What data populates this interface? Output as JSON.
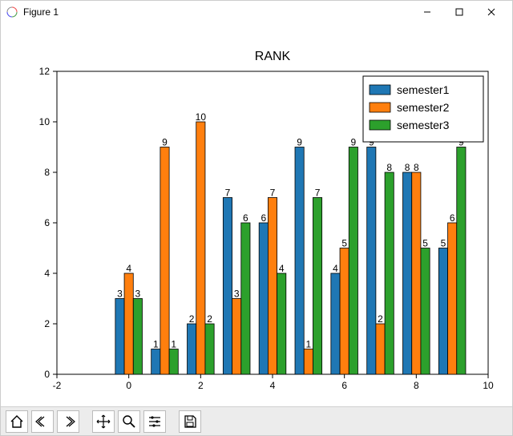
{
  "window": {
    "title": "Figure 1"
  },
  "toolbar_icons": {
    "home": "home-icon",
    "back": "back-icon",
    "forward": "forward-icon",
    "pan": "pan-icon",
    "zoom": "zoom-icon",
    "configure": "configure-icon",
    "save": "save-icon"
  },
  "chart_data": {
    "type": "bar",
    "title": "RANK",
    "xlabel": "",
    "ylabel": "",
    "xlim": [
      -2,
      10
    ],
    "ylim": [
      0,
      12
    ],
    "xticks": [
      -2,
      0,
      2,
      4,
      6,
      8,
      10
    ],
    "yticks": [
      0,
      2,
      4,
      6,
      8,
      10,
      12
    ],
    "categories": [
      0,
      1,
      2,
      3,
      4,
      5,
      6,
      7,
      8,
      9
    ],
    "series": [
      {
        "name": "semester1",
        "color": "#1f77b4",
        "values": [
          3,
          1,
          2,
          7,
          6,
          9,
          4,
          9,
          8,
          5
        ]
      },
      {
        "name": "semester2",
        "color": "#ff7f0e",
        "values": [
          4,
          9,
          10,
          3,
          7,
          1,
          5,
          2,
          8,
          6
        ]
      },
      {
        "name": "semester3",
        "color": "#2ca02c",
        "values": [
          3,
          1,
          2,
          6,
          4,
          7,
          9,
          8,
          5,
          9
        ]
      }
    ],
    "legend_loc": "upper-right",
    "bar_width": 0.25
  }
}
